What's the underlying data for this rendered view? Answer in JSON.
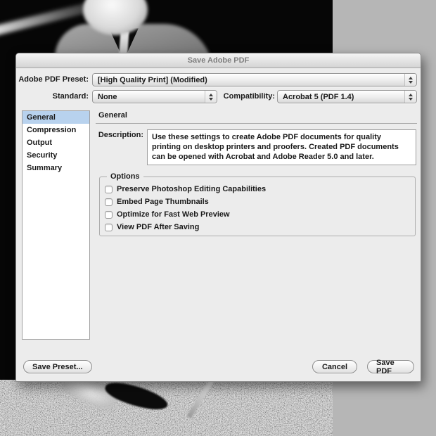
{
  "window": {
    "title": "Save Adobe PDF"
  },
  "presets": {
    "adobe_pdf_preset": {
      "label": "Adobe PDF Preset:",
      "value": "[High Quality Print] (Modified)"
    },
    "standard": {
      "label": "Standard:",
      "value": "None"
    },
    "compatibility": {
      "label": "Compatibility:",
      "value": "Acrobat 5 (PDF 1.4)"
    }
  },
  "sidebar": {
    "items": [
      {
        "label": "General",
        "selected": true
      },
      {
        "label": "Compression",
        "selected": false
      },
      {
        "label": "Output",
        "selected": false
      },
      {
        "label": "Security",
        "selected": false
      },
      {
        "label": "Summary",
        "selected": false
      }
    ]
  },
  "panel": {
    "heading": "General",
    "description": {
      "label": "Description:",
      "text": "Use these settings to create Adobe PDF documents for quality printing on desktop printers and proofers.  Created PDF documents can be opened with Acrobat and Adobe Reader 5.0 and later."
    },
    "options": {
      "legend": "Options",
      "checkboxes": [
        {
          "label": "Preserve Photoshop Editing Capabilities",
          "checked": false
        },
        {
          "label": "Embed Page Thumbnails",
          "checked": false
        },
        {
          "label": "Optimize for Fast Web Preview",
          "checked": false
        },
        {
          "label": "View PDF After Saving",
          "checked": false
        }
      ]
    }
  },
  "footer": {
    "save_preset": "Save Preset...",
    "cancel": "Cancel",
    "save_pdf": "Save PDF"
  },
  "colors": {
    "selection_blue": "#b8d2ee",
    "dialog_bg": "#ececec",
    "titlebar_top": "#f5f5f5",
    "titlebar_bottom": "#d4d4d4",
    "title_text": "#7d7d7d",
    "desktop_gray": "#b6b6b6"
  }
}
